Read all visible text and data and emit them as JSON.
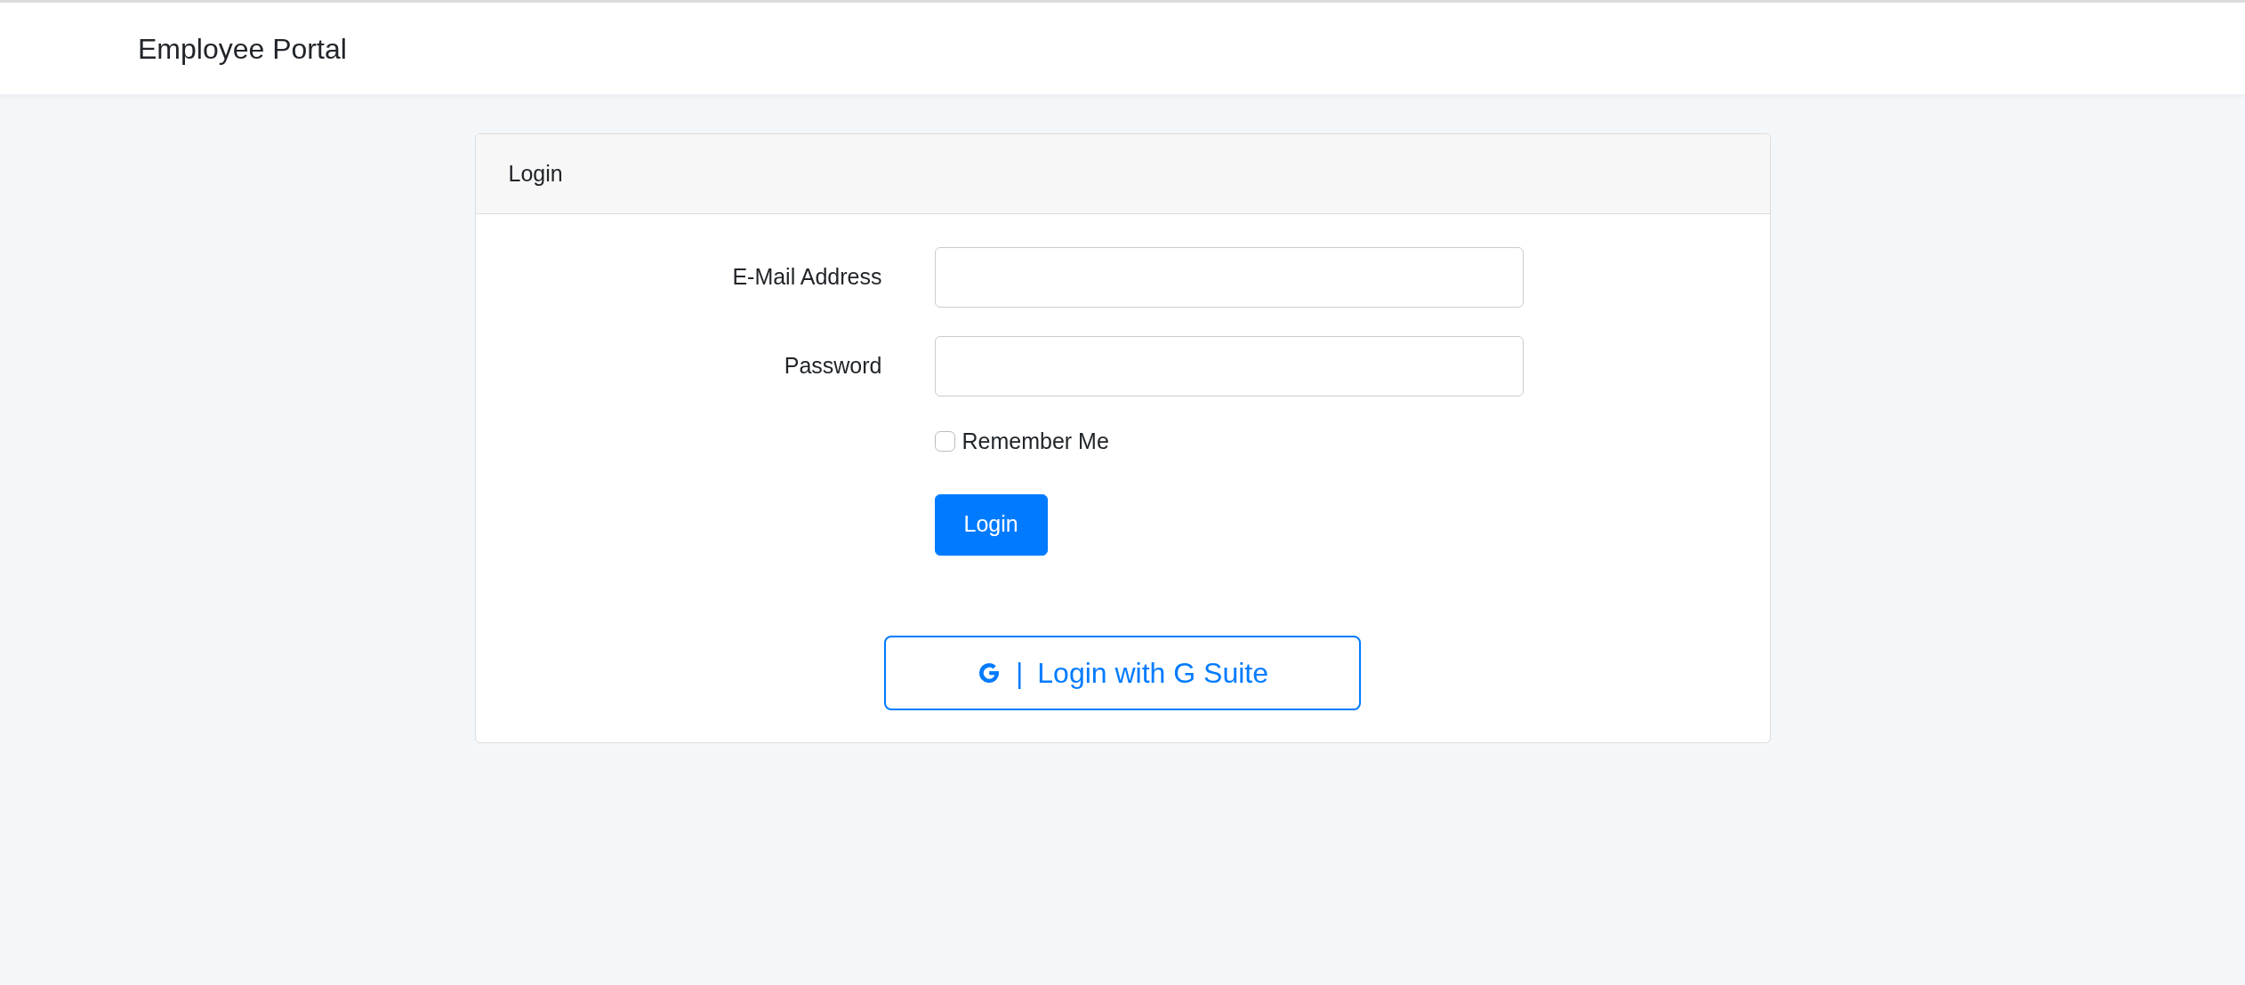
{
  "navbar": {
    "brand": "Employee Portal"
  },
  "card": {
    "title": "Login",
    "fields": [
      {
        "label": "E-Mail Address"
      },
      {
        "label": "Password"
      }
    ],
    "remember": {
      "label": "Remember Me",
      "checked": false
    },
    "submit": "Login",
    "sso": {
      "separator": "|",
      "label": "Login with G Suite"
    }
  }
}
